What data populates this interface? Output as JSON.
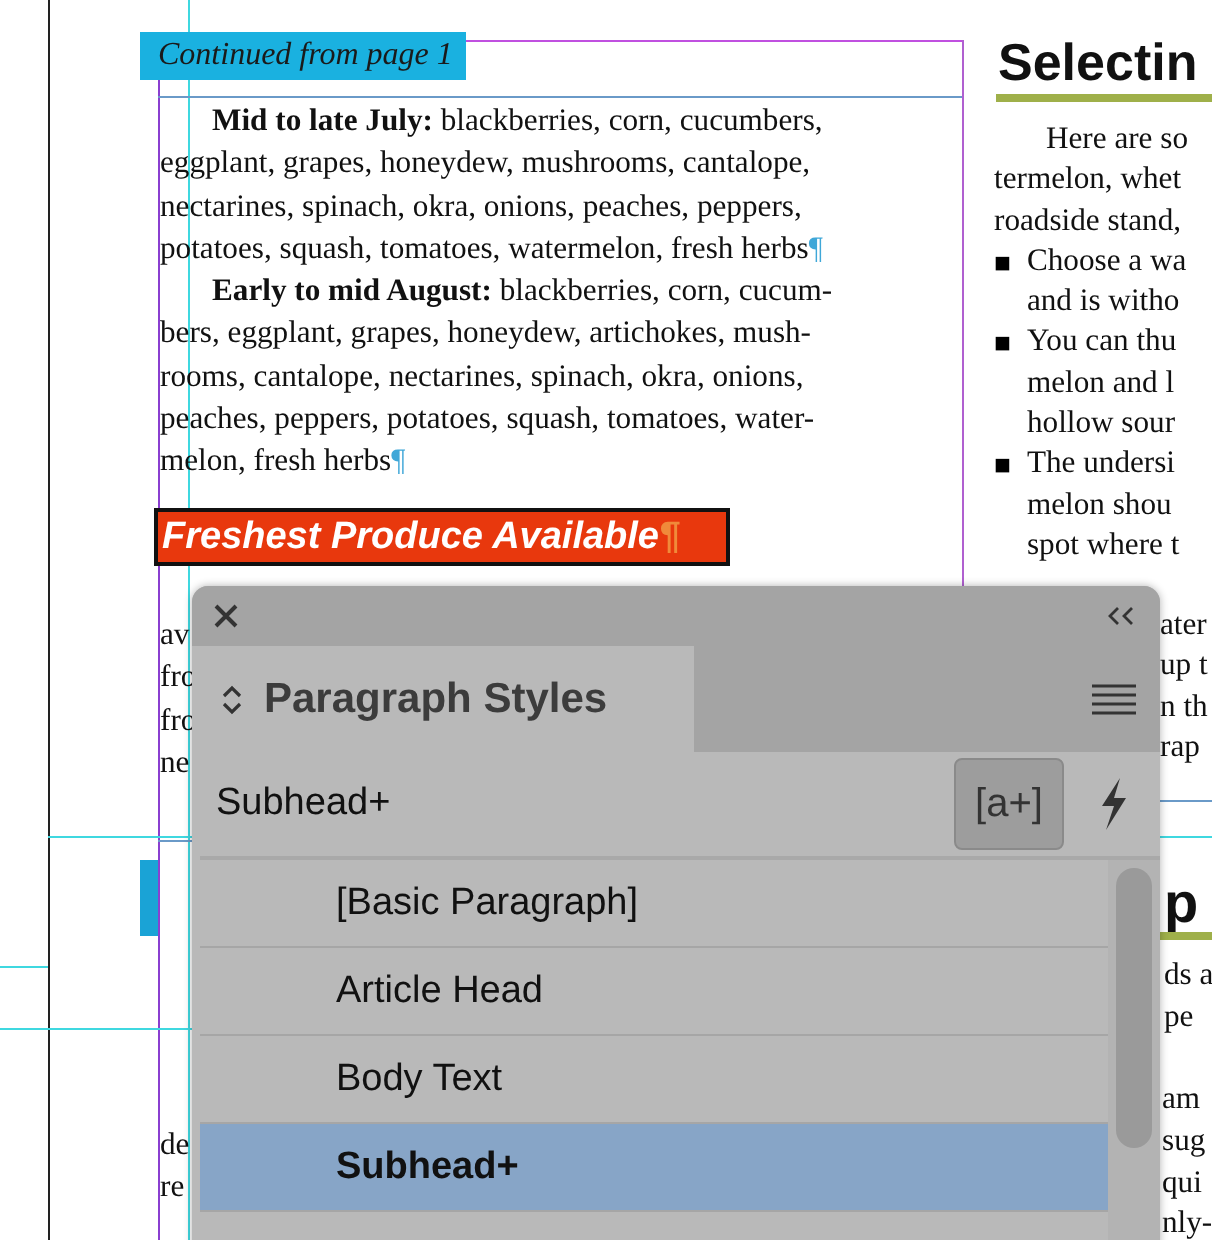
{
  "document": {
    "continued_label": "Continued from page 1",
    "left_column": {
      "paragraphs": [
        {
          "lines": [
            "**Mid to late July:** blackberries, corn, cucumbers,",
            "eggplant, grapes, honeydew, mushrooms, cantalope,",
            "nectarines, spinach, okra, onions, peaches, peppers,",
            "potatoes, squash, tomatoes, watermelon, fresh herbs"
          ],
          "pilcrow": "¶"
        },
        {
          "lines": [
            "**Early to mid August:** blackberries, corn, cucum-",
            "bers, eggplant, grapes, honeydew, artichokes, mush-",
            "rooms, cantalope, nectarines, spinach, okra, onions,",
            "peaches, peppers, potatoes, squash, tomatoes, water-",
            "melon, fresh herbs"
          ],
          "pilcrow": "¶"
        }
      ],
      "heading": "Freshest Produce Available",
      "heading_pilcrow": "¶",
      "fragments": [
        "av",
        "fro",
        "fro",
        "ne"
      ],
      "lower_fragments": [
        "de",
        "re"
      ]
    },
    "right_column": {
      "heading": "Selectin",
      "intro_lines": [
        "Here are so",
        "termelon, whet",
        "roadside stand,"
      ],
      "bullets": [
        {
          "marker": "■",
          "lines": [
            "Choose a wa",
            "and is witho"
          ]
        },
        {
          "marker": "■",
          "lines": [
            "You can thu",
            "melon and l",
            "hollow sour"
          ]
        },
        {
          "marker": "■",
          "lines": [
            "The undersi",
            "melon shou",
            "spot where t"
          ]
        }
      ],
      "continued_lines": [
        "ater",
        "up t",
        "n th",
        "rap"
      ],
      "heading_2": "p",
      "lower_lines": [
        "ds a",
        "pe"
      ],
      "lower_lines_2": [
        "am",
        "sug",
        "qui",
        "nly-"
      ]
    }
  },
  "panel": {
    "title": "Paragraph Styles",
    "current_style": "Subhead+",
    "new_style_button": "[a+]",
    "styles": [
      {
        "name": "[Basic Paragraph]",
        "selected": false
      },
      {
        "name": "Article Head",
        "selected": false
      },
      {
        "name": "Body Text",
        "selected": false
      },
      {
        "name": "Subhead+",
        "selected": true
      }
    ]
  }
}
